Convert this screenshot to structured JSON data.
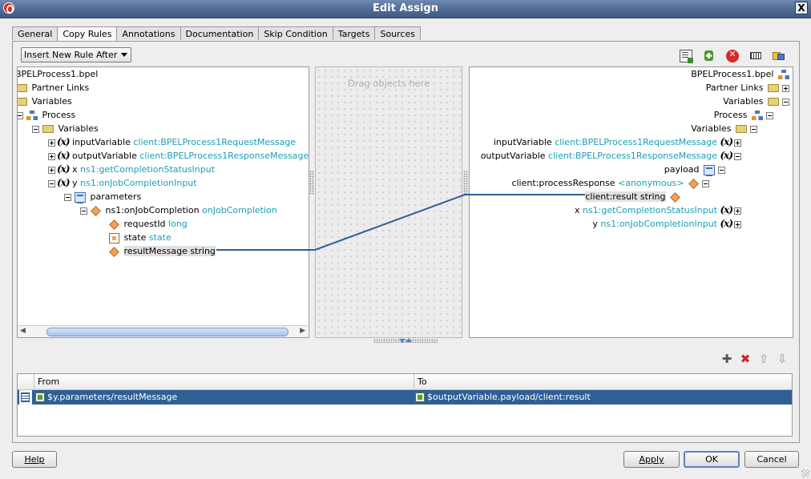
{
  "window": {
    "title": "Edit Assign",
    "close_label": "X"
  },
  "tabs": [
    {
      "label": "General"
    },
    {
      "label": "Copy Rules",
      "active": true
    },
    {
      "label": "Annotations"
    },
    {
      "label": "Documentation"
    },
    {
      "label": "Skip Condition"
    },
    {
      "label": "Targets"
    },
    {
      "label": "Sources"
    }
  ],
  "toolbar": {
    "insert_rule_option": "Insert New Rule After",
    "icons": [
      "expression-icon",
      "add-green-icon",
      "delete-red-icon",
      "literal-icon",
      "xml-fragment-icon"
    ]
  },
  "drag_hint": "Drag objects here",
  "source_tree": {
    "root": "BPELProcess1.bpel",
    "partner_links": "Partner Links",
    "variables_top": "Variables",
    "process": "Process",
    "variables": "Variables",
    "input_name": "inputVariable",
    "input_type": "client:BPELProcess1RequestMessage",
    "output_name": "outputVariable",
    "output_type": "client:BPELProcess1ResponseMessage",
    "x_name": "x",
    "x_type": "ns1:getCompletionStatusInput",
    "y_name": "y",
    "y_type": "ns1:onJobCompletionInput",
    "parameters": "parameters",
    "job_name": "ns1:onJobCompletion",
    "job_type": "onJobCompletion",
    "request_name": "requestId",
    "request_type": "long",
    "state_name": "state",
    "state_type": "state",
    "result_label": "resultMessage string"
  },
  "target_tree": {
    "root": "BPELProcess1.bpel",
    "partner_links": "Partner Links",
    "variables_top": "Variables",
    "process": "Process",
    "variables": "Variables",
    "input_name": "inputVariable",
    "input_type": "client:BPELProcess1RequestMessage",
    "output_name": "outputVariable",
    "output_type": "client:BPELProcess1ResponseMessage",
    "payload": "payload",
    "response_name": "client:processResponse",
    "response_type": "<anonymous>",
    "result_label": "client:result string",
    "x_name": "x",
    "x_type": "ns1:getCompletionStatusInput",
    "y_name": "y",
    "y_type": "ns1:onJobCompletionInput"
  },
  "rules_table": {
    "headers": {
      "from": "From",
      "to": "To"
    },
    "rows": [
      {
        "from": "$y.parameters/resultMessage",
        "to": "$outputVariable.payload/client:result"
      }
    ]
  },
  "buttons": {
    "help": "Help",
    "apply": "Apply",
    "ok": "OK",
    "cancel": "Cancel"
  },
  "colors": {
    "type_text": "#1a9fb3",
    "selection": "#2f5f95",
    "titlebar": "#506b94",
    "connector": "#2f5f95"
  }
}
